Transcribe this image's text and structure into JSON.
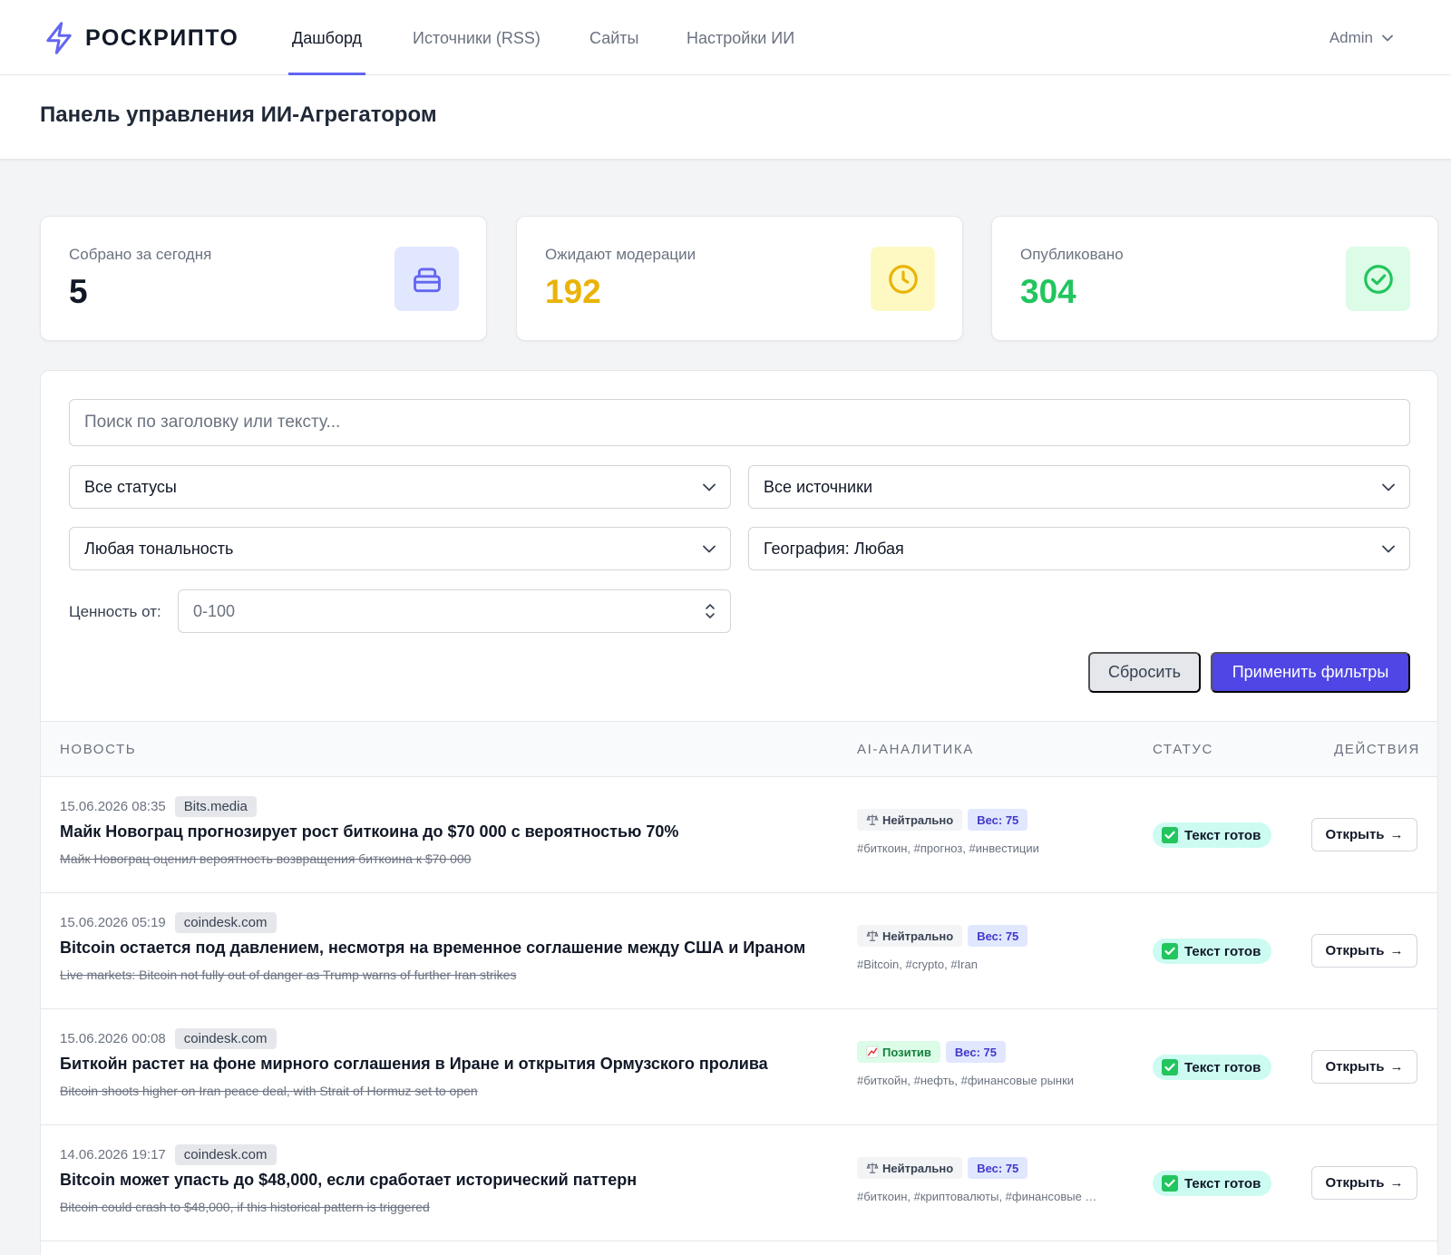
{
  "brand": {
    "name": "РОСКРИПТО",
    "icon": "bolt-icon"
  },
  "nav": [
    {
      "label": "Дашборд",
      "active": true
    },
    {
      "label": "Источники (RSS)",
      "active": false
    },
    {
      "label": "Сайты",
      "active": false
    },
    {
      "label": "Настройки ИИ",
      "active": false
    }
  ],
  "user": {
    "name": "Admin"
  },
  "page": {
    "title": "Панель управления ИИ-Агрегатором"
  },
  "stats": [
    {
      "label": "Собрано за сегодня",
      "value": "5",
      "color": "#111827",
      "icon": "inbox-icon",
      "icon_bg": "#e0e7ff",
      "icon_color": "#6366f1"
    },
    {
      "label": "Ожидают модерации",
      "value": "192",
      "color": "#eab308",
      "icon": "clock-icon",
      "icon_bg": "#fef9c3",
      "icon_color": "#eab308"
    },
    {
      "label": "Опубликовано",
      "value": "304",
      "color": "#22c55e",
      "icon": "check-circle-icon",
      "icon_bg": "#dcfce7",
      "icon_color": "#22c55e"
    }
  ],
  "filters": {
    "search_placeholder": "Поиск по заголовку или тексту...",
    "status": "Все статусы",
    "source": "Все источники",
    "tone": "Любая тональность",
    "geo": "География: Любая",
    "value_label": "Ценность от:",
    "value_placeholder": "0-100",
    "reset": "Сбросить",
    "apply": "Применить фильтры"
  },
  "table": {
    "headers": {
      "news": "Новость",
      "ai": "AI-Аналитика",
      "status": "Статус",
      "actions": "Действия"
    },
    "rows": [
      {
        "date": "15.06.2026 08:35",
        "source": "Bits.media",
        "title": "Майк Новограц прогнозирует рост биткоина до $70 000 с вероятностью 70%",
        "original": "Майк Новограц оценил вероятность возвращения биткоина к $70 000",
        "sentiment": "Нейтрально",
        "sentiment_type": "neutral",
        "weight": "Вес: 75",
        "tags": "#биткоин, #прогноз, #инвестиции",
        "status": "Текст готов",
        "action": "Открыть"
      },
      {
        "date": "15.06.2026 05:19",
        "source": "coindesk.com",
        "title": "Bitcoin остается под давлением, несмотря на временное соглашение между США и Ираном",
        "original": "Live markets: Bitcoin not fully out of danger as Trump warns of further Iran strikes",
        "sentiment": "Нейтрально",
        "sentiment_type": "neutral",
        "weight": "Вес: 75",
        "tags": "#Bitcoin, #crypto, #Iran",
        "status": "Текст готов",
        "action": "Открыть"
      },
      {
        "date": "15.06.2026 00:08",
        "source": "coindesk.com",
        "title": "Биткойн растет на фоне мирного соглашения в Иране и открытия Ормузского пролива",
        "original": "Bitcoin shoots higher on Iran peace deal, with Strait of Hormuz set to open",
        "sentiment": "Позитив",
        "sentiment_type": "positive",
        "weight": "Вес: 75",
        "tags": "#биткойн, #нефть, #финансовые рынки",
        "status": "Текст готов",
        "action": "Открыть"
      },
      {
        "date": "14.06.2026 19:17",
        "source": "coindesk.com",
        "title": "Bitcoin может упасть до $48,000, если сработает исторический паттерн",
        "original": "Bitcoin could crash to $48,000, if this historical pattern is triggered",
        "sentiment": "Нейтрально",
        "sentiment_type": "neutral",
        "weight": "Вес: 75",
        "tags": "#биткоин, #криптовалюты, #финансовые рынки",
        "status": "Текст готов",
        "action": "Открыть"
      }
    ]
  }
}
